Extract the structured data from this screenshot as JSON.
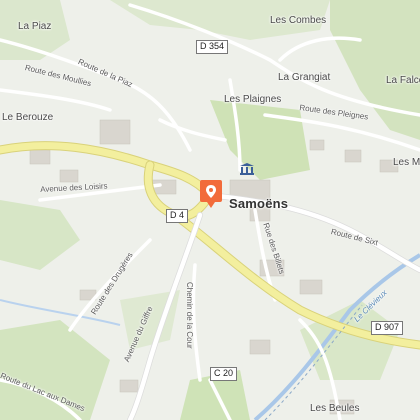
{
  "map": {
    "places": {
      "la_piaz": "La Piaz",
      "les_combes": "Les Combes",
      "la_grangiat": "La Grangiat",
      "la_falco": "La Falco",
      "les_plaignes": "Les Plaignes",
      "le_berouze": "Le Berouze",
      "les_mo": "Les Mo",
      "samoens": "Samoëns",
      "les_beules": "Les Beules"
    },
    "roads": {
      "route_piaz": "Route de la Piaz",
      "route_moullies": "Route des Moullies",
      "route_pleignes": "Route des Pleignes",
      "avenue_loisirs": "Avenue des Loisirs",
      "route_drugeres": "Route des Drugères",
      "avenue_giffre": "Avenue du Giffre",
      "chemin_cour": "Chemin de la Cour",
      "rue_billets": "Rue des Billets",
      "route_sixt": "Route de Sixt",
      "route_lac_dames": "Route du Lac aux Dames"
    },
    "river": "Le Clévieux",
    "shields": {
      "d354": "D 354",
      "d4": "D 4",
      "d907": "D 907",
      "c20": "C 20"
    },
    "icons": {
      "marker": "location-pin-icon",
      "museum": "museum-icon"
    },
    "colors": {
      "marker": "#f26b3a",
      "main_road": "#f3ef9e",
      "forest": "#d5e6c4",
      "park": "#c9e1ae",
      "river": "#a9c7e8"
    }
  }
}
